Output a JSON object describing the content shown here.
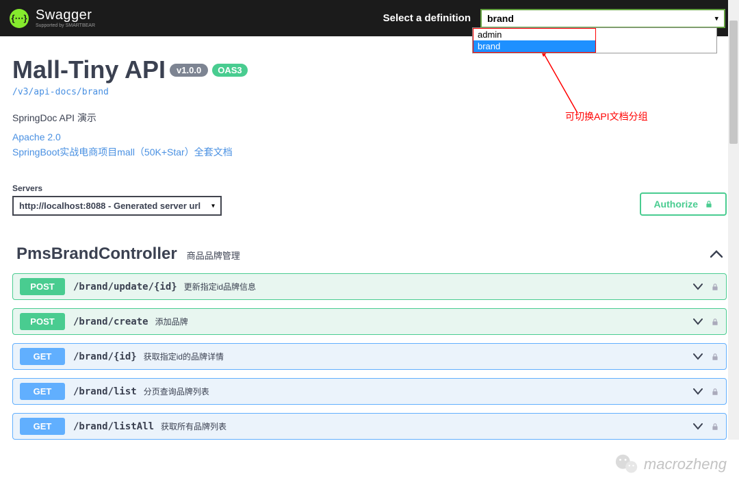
{
  "topbar": {
    "logo_text": "Swagger",
    "logo_sub": "Supported by SMARTBEAR",
    "logo_glyph": "{⋯}",
    "select_label": "Select a definition",
    "selected_value": "brand",
    "dropdown_options": [
      "admin",
      "brand"
    ]
  },
  "annotation": {
    "text": "可切换API文档分组"
  },
  "info": {
    "title": "Mall-Tiny API",
    "version": "v1.0.0",
    "oas": "OAS3",
    "url": "/v3/api-docs/brand",
    "description": "SpringDoc API 演示",
    "links": [
      "Apache 2.0",
      "SpringBoot实战电商项目mall（50K+Star）全套文档"
    ]
  },
  "servers": {
    "label": "Servers",
    "selected": "http://localhost:8088 - Generated server url"
  },
  "authorize": {
    "label": "Authorize"
  },
  "tag": {
    "name": "PmsBrandController",
    "description": "商品品牌管理"
  },
  "operations": [
    {
      "method": "POST",
      "class": "post",
      "path": "/brand/update/{id}",
      "summary": "更新指定id品牌信息"
    },
    {
      "method": "POST",
      "class": "post",
      "path": "/brand/create",
      "summary": "添加品牌"
    },
    {
      "method": "GET",
      "class": "get",
      "path": "/brand/{id}",
      "summary": "获取指定id的品牌详情"
    },
    {
      "method": "GET",
      "class": "get",
      "path": "/brand/list",
      "summary": "分页查询品牌列表"
    },
    {
      "method": "GET",
      "class": "get",
      "path": "/brand/listAll",
      "summary": "获取所有品牌列表"
    }
  ],
  "watermark": {
    "text": "macrozheng"
  }
}
